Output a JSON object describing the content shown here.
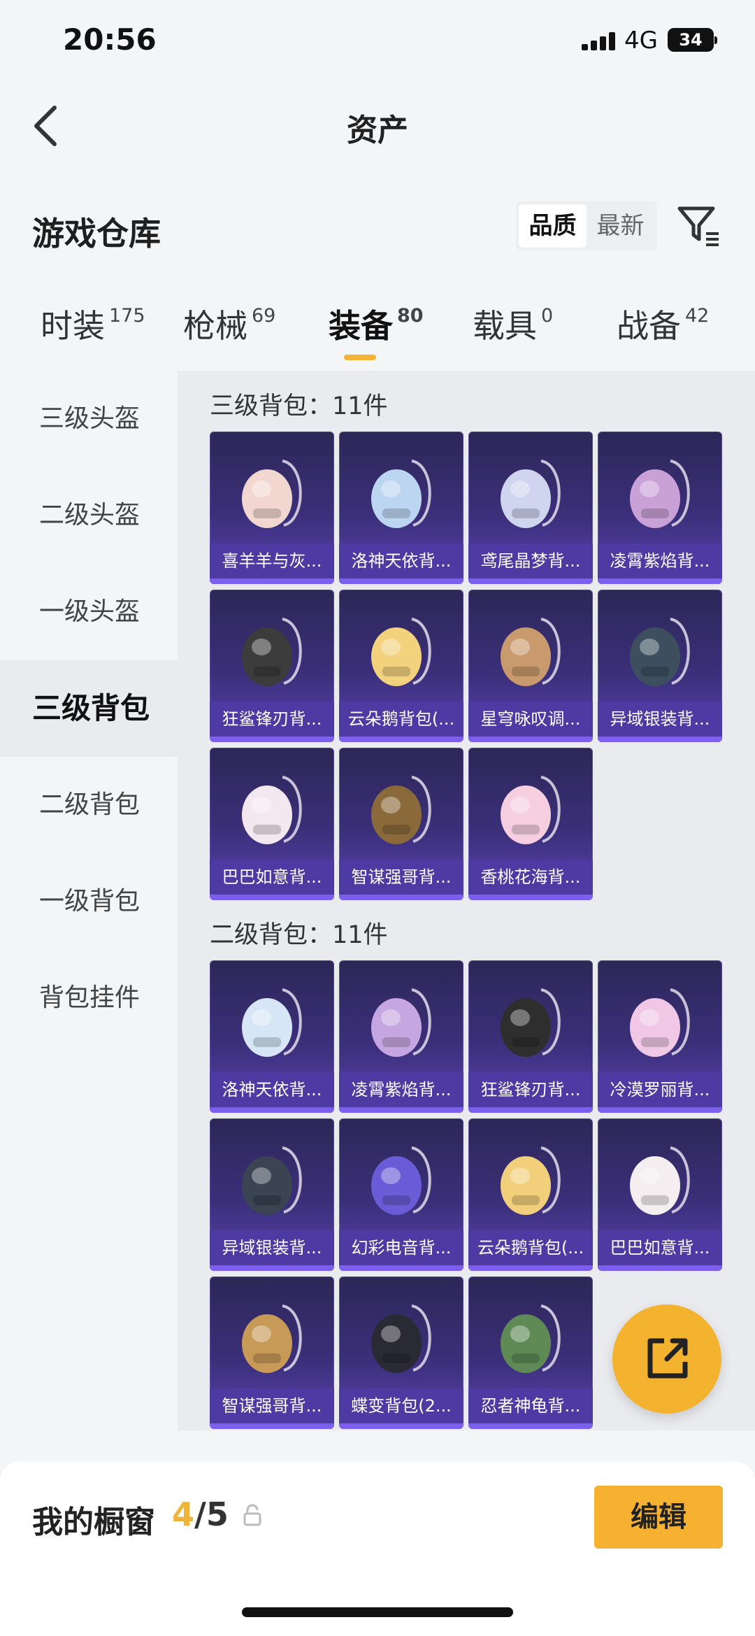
{
  "status": {
    "time": "20:56",
    "network": "4G",
    "battery": "34"
  },
  "nav": {
    "title": "资产"
  },
  "warehouse": {
    "title": "游戏仓库",
    "sort_options": [
      "品质",
      "最新"
    ],
    "sort_selected": "品质"
  },
  "tabs": [
    {
      "label": "时装",
      "count": "175"
    },
    {
      "label": "枪械",
      "count": "69"
    },
    {
      "label": "装备",
      "count": "80"
    },
    {
      "label": "载具",
      "count": "0"
    },
    {
      "label": "战备",
      "count": "42"
    }
  ],
  "active_tab": "装备",
  "side": [
    {
      "label": "三级头盔"
    },
    {
      "label": "二级头盔"
    },
    {
      "label": "一级头盔"
    },
    {
      "label": "三级背包"
    },
    {
      "label": "二级背包"
    },
    {
      "label": "一级背包"
    },
    {
      "label": "背包挂件"
    }
  ],
  "active_side": "三级背包",
  "sections": [
    {
      "title": "三级背包：11件",
      "items": [
        {
          "name": "喜羊羊与灰...",
          "color": "#f1d7d0"
        },
        {
          "name": "洛神天依背...",
          "color": "#bcd6f2"
        },
        {
          "name": "鸢尾晶梦背...",
          "color": "#cfd4ef"
        },
        {
          "name": "凌霄紫焰背...",
          "color": "#c9a1d6"
        },
        {
          "name": "狂鲨锋刃背...",
          "color": "#3c3c3c"
        },
        {
          "name": "云朵鹅背包(...",
          "color": "#f3d27e"
        },
        {
          "name": "星穹咏叹调...",
          "color": "#c99a6d"
        },
        {
          "name": "异域银装背...",
          "color": "#3d4f5e"
        },
        {
          "name": "巴巴如意背...",
          "color": "#f3e8f0"
        },
        {
          "name": "智谋强哥背...",
          "color": "#8a6a3a"
        },
        {
          "name": "香桃花海背...",
          "color": "#f5cfe0"
        }
      ]
    },
    {
      "title": "二级背包：11件",
      "items": [
        {
          "name": "洛神天依背...",
          "color": "#d6e6f7"
        },
        {
          "name": "凌霄紫焰背...",
          "color": "#c6a6e0"
        },
        {
          "name": "狂鲨锋刃背...",
          "color": "#2e2e2e"
        },
        {
          "name": "冷漠罗丽背...",
          "color": "#f0c8e6"
        },
        {
          "name": "异域银装背...",
          "color": "#3a4452"
        },
        {
          "name": "幻彩电音背...",
          "color": "#6a5bd6"
        },
        {
          "name": "云朵鹅背包(...",
          "color": "#f2cf7a"
        },
        {
          "name": "巴巴如意背...",
          "color": "#f4eef0"
        },
        {
          "name": "智谋强哥背...",
          "color": "#c79a58"
        },
        {
          "name": "蝶变背包(2...",
          "color": "#2a2a34"
        },
        {
          "name": "忍者神龟背...",
          "color": "#5f8a56"
        }
      ]
    }
  ],
  "showcase": {
    "label": "我的橱窗",
    "current": "4",
    "total": "/5",
    "edit_label": "编辑"
  },
  "colors": {
    "accent": "#f5b335",
    "card_bg": "#3b2f7a",
    "card_label": "#4d3aa3"
  }
}
